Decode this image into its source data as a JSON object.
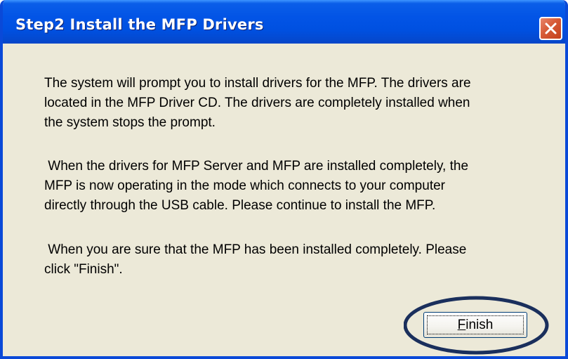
{
  "window": {
    "title": "Step2 Install the MFP Drivers"
  },
  "titlebar": {
    "close_icon": "close-icon"
  },
  "content": {
    "paragraphs": [
      "The system will prompt you to install drivers for the MFP. The drivers are\nlocated in the MFP Driver CD. The drivers are completely installed when\nthe system stops the prompt.",
      " When the drivers for MFP Server and MFP are installed completely, the\nMFP is now operating in the mode which connects to your computer\ndirectly through the USB cable. Please continue to install the MFP.",
      " When you are sure that the MFP has been installed completely. Please\nclick \"Finish\"."
    ]
  },
  "buttons": {
    "finish_label": "Finish",
    "finish_mnemonic": "F",
    "finish_rest": "inish"
  },
  "colors": {
    "titlebar": "#0254e6",
    "dialog_face": "#ece9d8",
    "close_button": "#d65a36",
    "highlight_ellipse": "#1a2f5c"
  }
}
